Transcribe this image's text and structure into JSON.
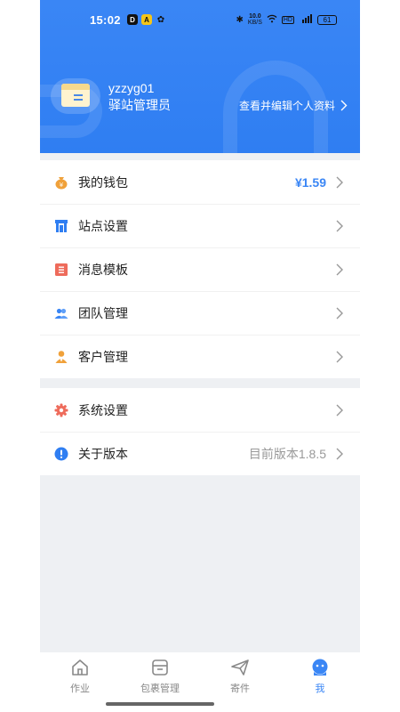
{
  "status_bar": {
    "time": "15:02",
    "app_badges": [
      "D",
      "A",
      "✿"
    ],
    "network_speed": "10.0",
    "network_unit": "KB/S",
    "battery": "61"
  },
  "profile": {
    "username": "yzzyg01",
    "role": "驿站管理员",
    "edit_link": "查看并编辑个人资料"
  },
  "menu_primary": [
    {
      "label": "我的钱包",
      "value": "¥1.59",
      "icon": "money-bag-icon",
      "color": "#f0a13a"
    },
    {
      "label": "站点设置",
      "value": "",
      "icon": "store-icon",
      "color": "#2f7ef2"
    },
    {
      "label": "消息模板",
      "value": "",
      "icon": "message-template-icon",
      "color": "#ee6b5b"
    },
    {
      "label": "团队管理",
      "value": "",
      "icon": "team-icon",
      "color": "#3a86f5"
    },
    {
      "label": "客户管理",
      "value": "",
      "icon": "customer-icon",
      "color": "#f0a13a"
    }
  ],
  "menu_secondary": [
    {
      "label": "系统设置",
      "value": "",
      "icon": "gear-icon",
      "color": "#ee6b5b"
    },
    {
      "label": "关于版本",
      "value": "目前版本1.8.5",
      "icon": "info-icon",
      "color": "#2f7ef2"
    }
  ],
  "bottom_nav": [
    {
      "label": "作业",
      "icon": "home-icon",
      "active": false
    },
    {
      "label": "包裹管理",
      "icon": "package-icon",
      "active": false
    },
    {
      "label": "寄件",
      "icon": "send-icon",
      "active": false
    },
    {
      "label": "我",
      "icon": "profile-icon",
      "active": true
    }
  ],
  "colors": {
    "brand_blue": "#3a86f5",
    "background": "#eef0f3",
    "text_muted": "#999999"
  }
}
